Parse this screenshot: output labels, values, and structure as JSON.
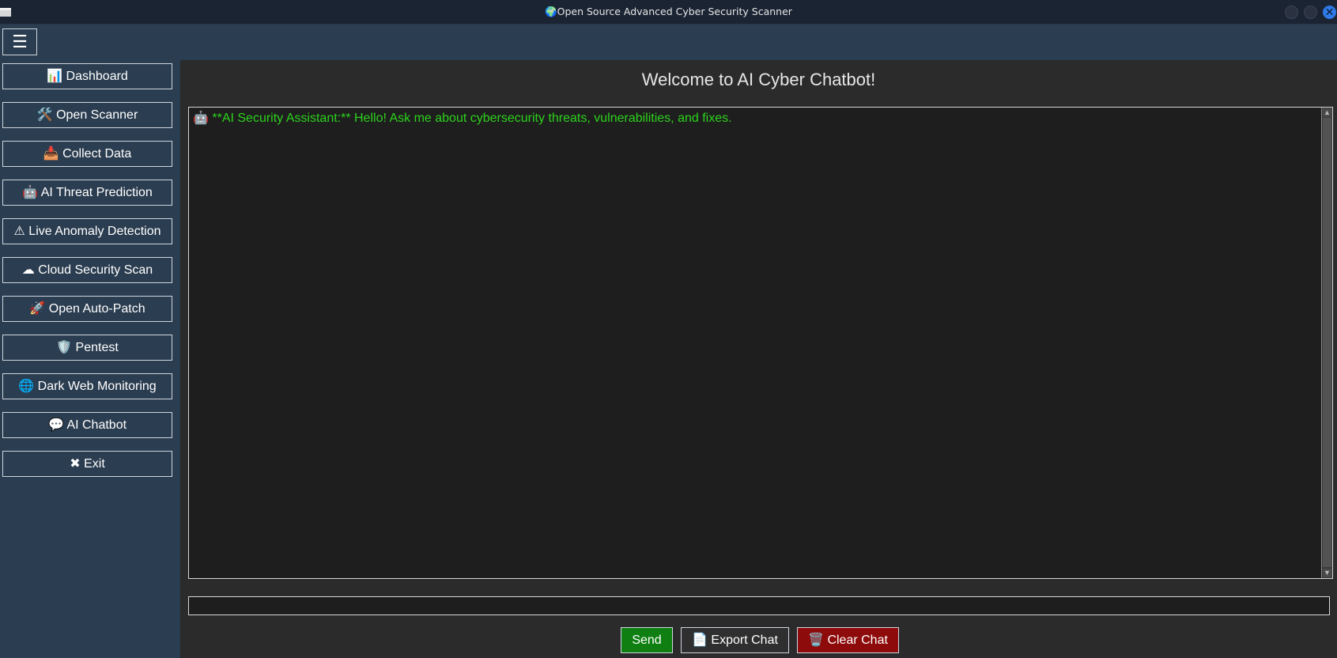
{
  "window": {
    "title": "🌍Open Source Advanced Cyber Security Scanner",
    "close_glyph": "✕",
    "colors": {
      "title_bar": "#1b2433",
      "close_button": "#2f7ae6"
    }
  },
  "topbar": {
    "menu_glyph": "☰"
  },
  "sidebar": {
    "background": "#2b3d50",
    "items": [
      {
        "label": "📊 Dashboard",
        "icon": "chart-icon"
      },
      {
        "label": "🛠️ Open Scanner",
        "icon": "tools-icon"
      },
      {
        "label": "📥 Collect Data",
        "icon": "inbox-icon"
      },
      {
        "label": "🤖 AI Threat Prediction",
        "icon": "robot-icon"
      },
      {
        "label": "⚠ Live Anomaly Detection",
        "icon": "warning-icon"
      },
      {
        "label": "☁ Cloud Security Scan",
        "icon": "cloud-icon"
      },
      {
        "label": "🚀 Open Auto-Patch",
        "icon": "rocket-icon"
      },
      {
        "label": "🛡️ Pentest",
        "icon": "shield-icon"
      },
      {
        "label": "🌐 Dark Web Monitoring",
        "icon": "globe-icon"
      },
      {
        "label": "💬 AI Chatbot",
        "icon": "speech-bubble-icon"
      },
      {
        "label": "✖ Exit",
        "icon": "close-icon"
      }
    ]
  },
  "main": {
    "heading": "Welcome to AI Cyber Chatbot!",
    "chat": {
      "messages": [
        {
          "text": "🤖 **AI Security Assistant:** Hello! Ask me about cybersecurity threats, vulnerabilities, and fixes.",
          "color": "#2cd21c"
        }
      ]
    },
    "input": {
      "value": ""
    },
    "buttons": {
      "send": "Send",
      "export": "📄 Export Chat",
      "clear": "🗑️ Clear Chat"
    },
    "colors": {
      "send": "#0f7f12",
      "clear": "#8e0b0b"
    }
  }
}
